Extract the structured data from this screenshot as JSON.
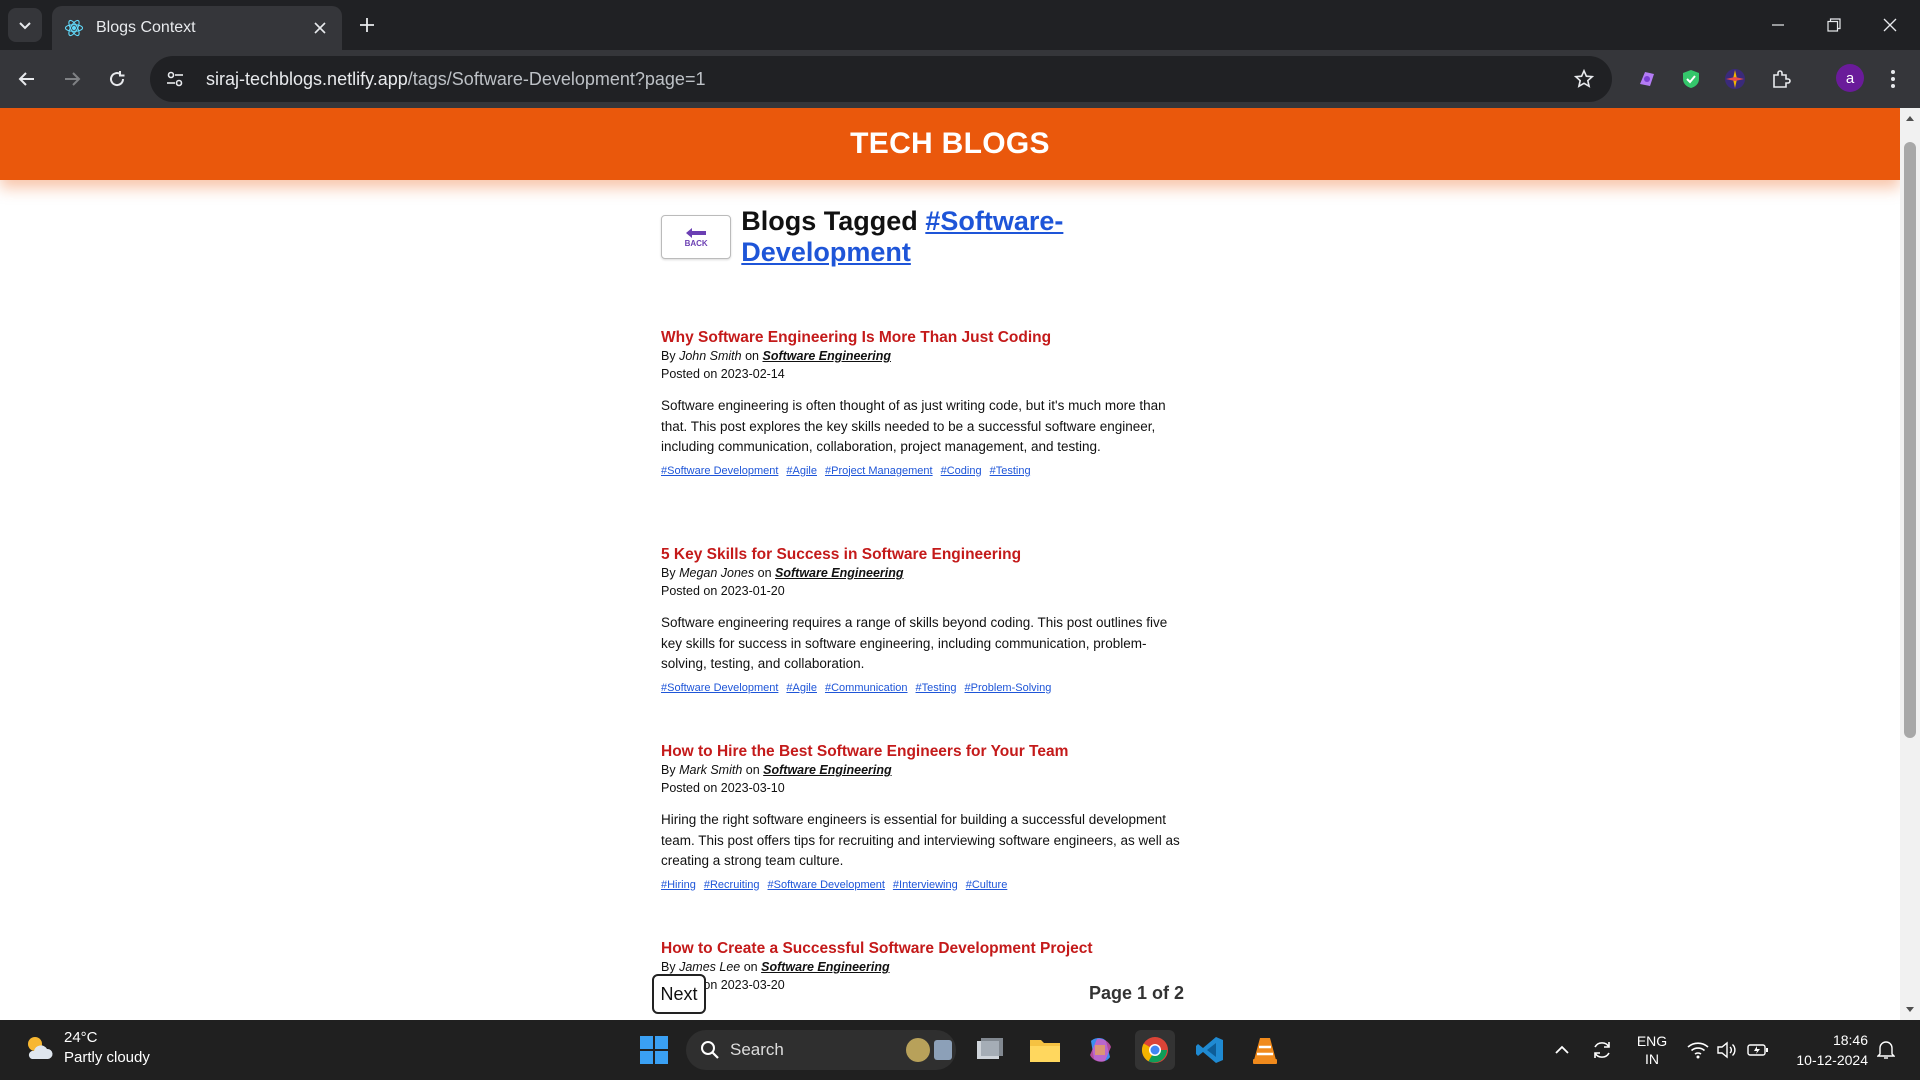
{
  "browser": {
    "tab_title": "Blogs Context",
    "url_host": "siraj-techblogs.netlify.app",
    "url_path": "/tags/Software-Development?page=1",
    "profile_initial": "a"
  },
  "site": {
    "title": "TECH BLOGS",
    "back_label": "BACK",
    "heading_prefix": "Blogs Tagged",
    "heading_tag": "#Software-Development"
  },
  "posts": [
    {
      "title": "Why Software Engineering Is More Than Just Coding",
      "by": "By",
      "author": "John Smith",
      "on": "on",
      "category": "Software Engineering",
      "posted": "Posted on 2023-02-14",
      "excerpt": "Software engineering is often thought of as just writing code, but it's much more than that. This post explores the key skills needed to be a successful software engineer, including communication, collaboration, project management, and testing.",
      "tags": [
        "#Software Development",
        "#Agile",
        "#Project Management",
        "#Coding",
        "#Testing"
      ]
    },
    {
      "title": "5 Key Skills for Success in Software Engineering",
      "by": "By",
      "author": "Megan Jones",
      "on": "on",
      "category": "Software Engineering",
      "posted": "Posted on 2023-01-20",
      "excerpt": "Software engineering requires a range of skills beyond coding. This post outlines five key skills for success in software engineering, including communication, problem-solving, testing, and collaboration.",
      "tags": [
        "#Software Development",
        "#Agile",
        "#Communication",
        "#Testing",
        "#Problem-Solving"
      ]
    },
    {
      "title": "How to Hire the Best Software Engineers for Your Team",
      "by": "By",
      "author": "Mark Smith",
      "on": "on",
      "category": "Software Engineering",
      "posted": "Posted on 2023-03-10",
      "excerpt": "Hiring the right software engineers is essential for building a successful development team. This post offers tips for recruiting and interviewing software engineers, as well as creating a strong team culture.",
      "tags": [
        "#Hiring",
        "#Recruiting",
        "#Software Development",
        "#Interviewing",
        "#Culture"
      ]
    },
    {
      "title": "How to Create a Successful Software Development Project",
      "by": "By",
      "author": "James Lee",
      "on": "on",
      "category": "Software Engineering",
      "posted": "Posted on 2023-03-20",
      "excerpt": "",
      "tags": []
    }
  ],
  "pagination": {
    "next_label": "Next",
    "page_info": "Page 1 of 2"
  },
  "taskbar": {
    "temperature": "24°C",
    "weather": "Partly cloudy",
    "search_label": "Search",
    "lang_top": "ENG",
    "lang_bottom": "IN",
    "time": "18:46",
    "date": "10-12-2024"
  },
  "colors": {
    "header_orange": "#ea580c",
    "post_title_red": "#c41a1a",
    "link_blue": "#1e55d8"
  }
}
